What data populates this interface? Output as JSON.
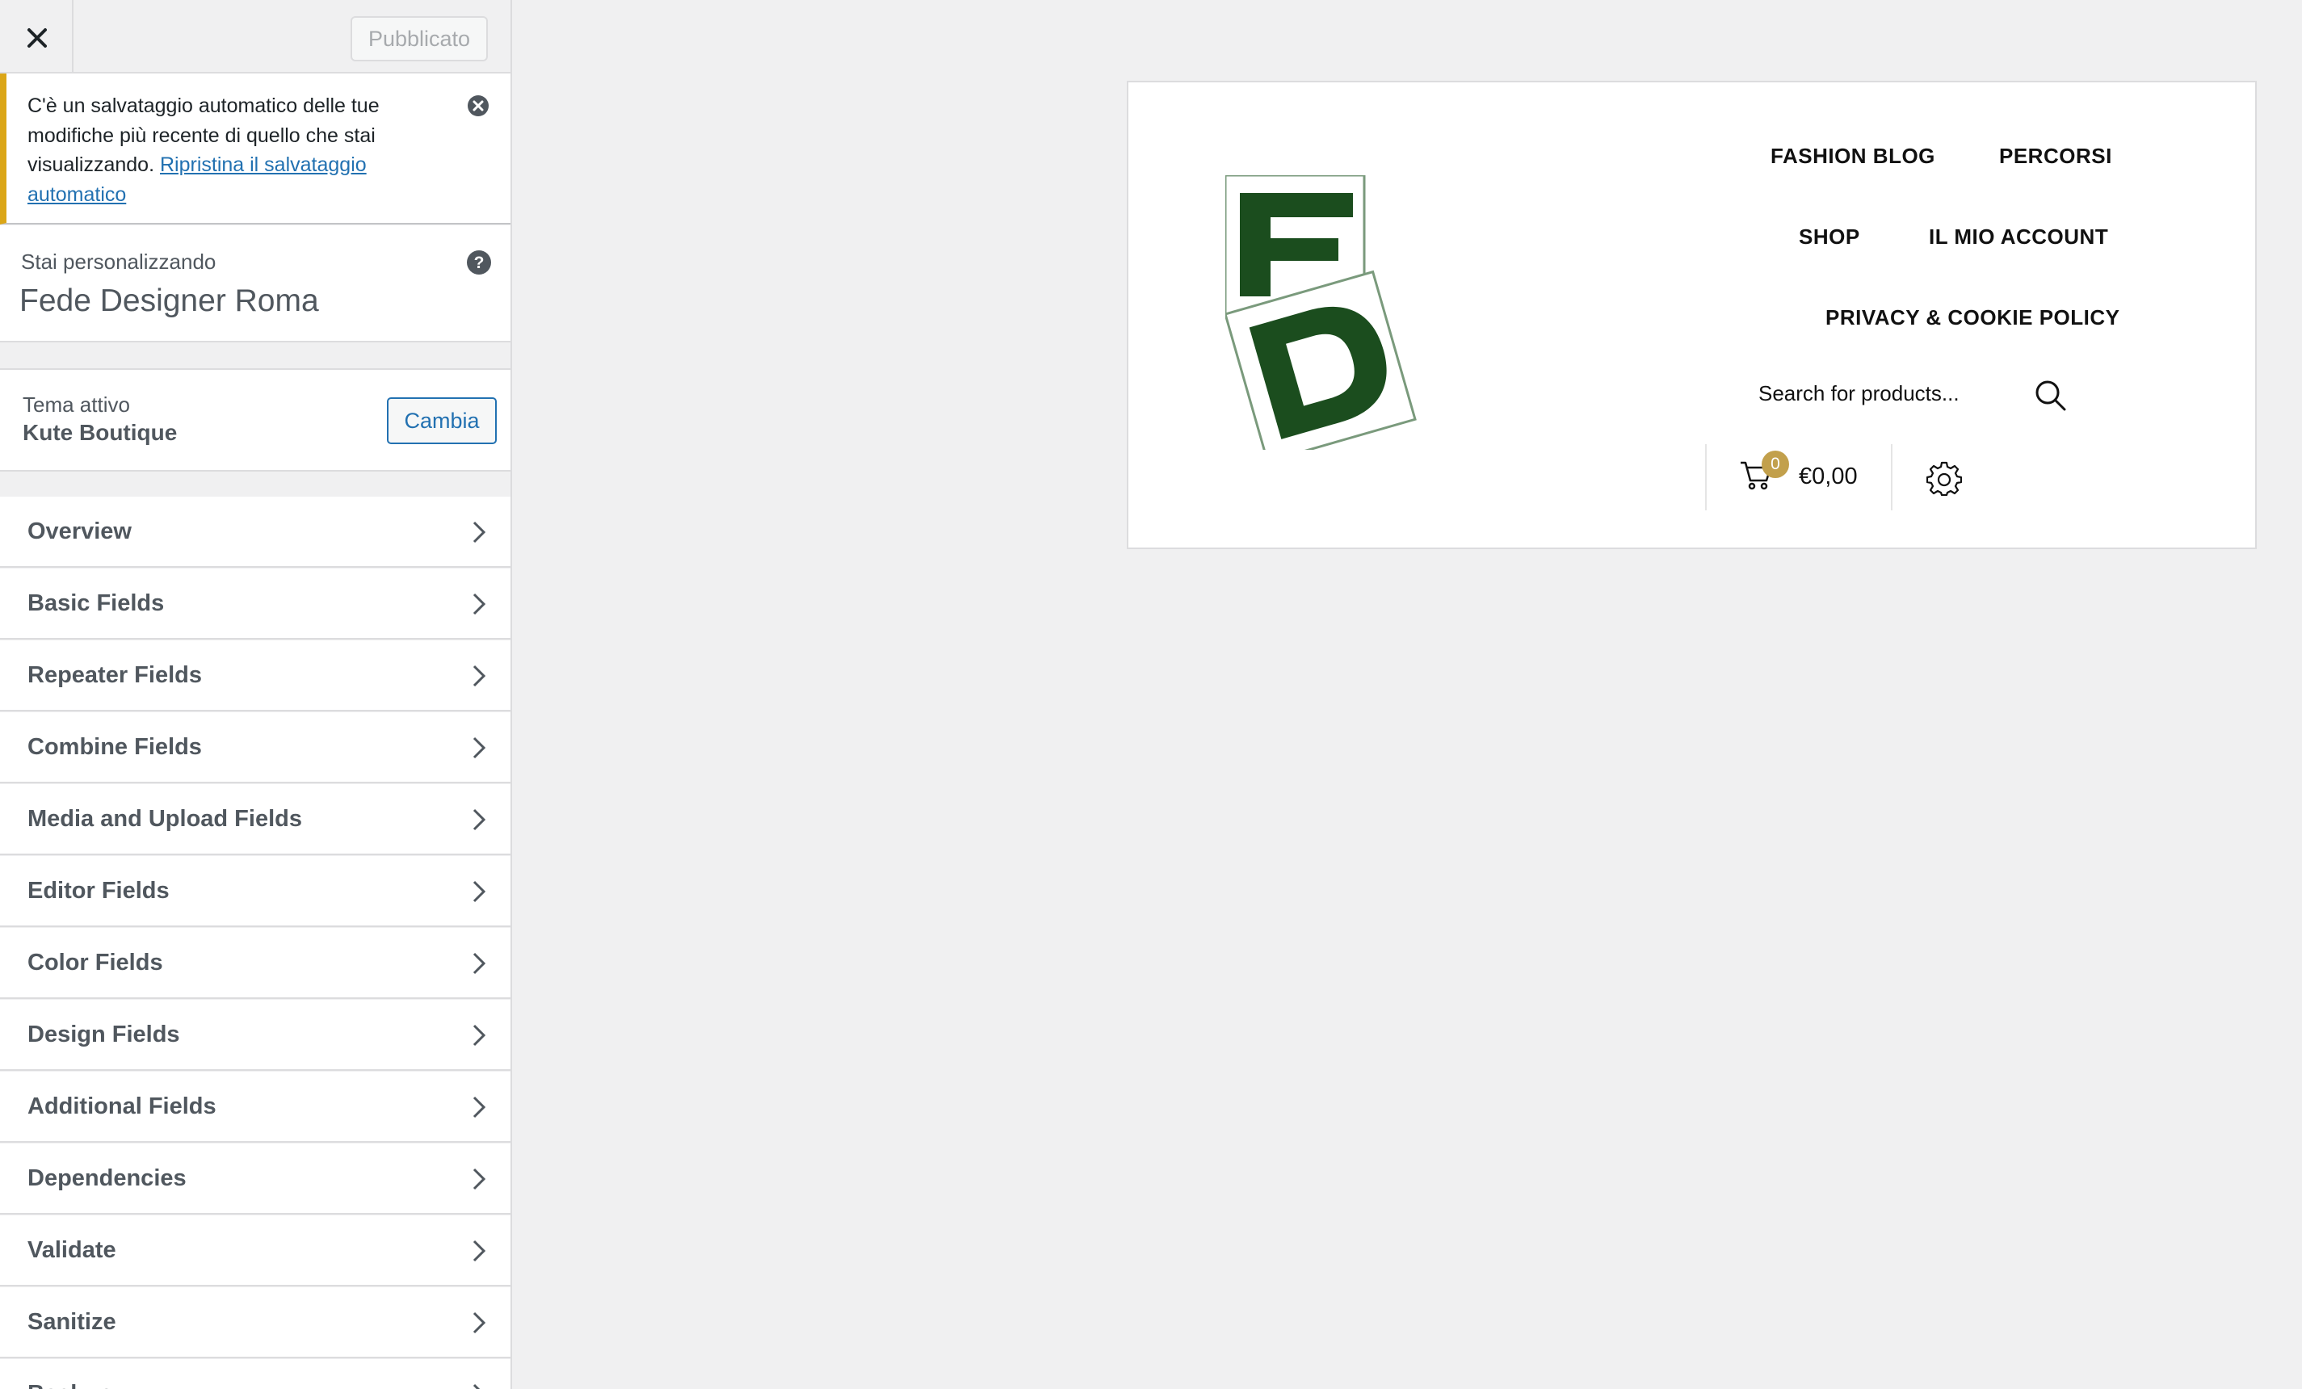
{
  "sidebar": {
    "close_icon": "close-icon",
    "publish_label": "Pubblicato",
    "notice": {
      "text": "C'è un salvataggio automatico delle tue modifiche più recente di quello che stai visualizzando.",
      "link": "Ripristina il salvataggio automatico",
      "dismiss_icon": "dismiss-icon",
      "accent_color": "#dba617"
    },
    "info": {
      "label": "Stai personalizzando",
      "site_title": "Fede Designer Roma",
      "help_icon": "help-icon"
    },
    "theme": {
      "label": "Tema attivo",
      "name": "Kute Boutique",
      "change_label": "Cambia"
    },
    "panels": [
      {
        "label": "Overview"
      },
      {
        "label": "Basic Fields"
      },
      {
        "label": "Repeater Fields"
      },
      {
        "label": "Combine Fields"
      },
      {
        "label": "Media and Upload Fields"
      },
      {
        "label": "Editor Fields"
      },
      {
        "label": "Color Fields"
      },
      {
        "label": "Design Fields"
      },
      {
        "label": "Additional Fields"
      },
      {
        "label": "Dependencies"
      },
      {
        "label": "Validate"
      },
      {
        "label": "Sanitize"
      },
      {
        "label": "Backup"
      }
    ]
  },
  "preview": {
    "logo": {
      "letters": "FD",
      "color": "#1b4d1e"
    },
    "nav": {
      "fashion_blog": "FASHION BLOG",
      "percorsi": "PERCORSI",
      "shop": "SHOP",
      "account": "IL MIO ACCOUNT",
      "privacy": "PRIVACY & COOKIE POLICY"
    },
    "search": {
      "placeholder": "Search for products...",
      "icon": "search-icon"
    },
    "cart": {
      "count": "0",
      "total": "€0,00",
      "icon": "cart-icon",
      "badge_color": "#c2a04c"
    },
    "settings_icon": "gear-icon"
  }
}
